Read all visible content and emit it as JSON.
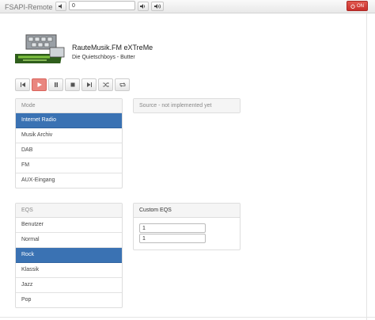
{
  "navbar": {
    "brand": "FSAPI-Remote",
    "volume_down_icon": "volume-down-icon",
    "volume_value": "0",
    "volume_up_icon": "volume-up-icon",
    "mute_icon": "mute-icon",
    "power_label": "ON",
    "power_icon": "power-icon",
    "power_color": "#d9534f"
  },
  "nowplaying": {
    "station": "RauteMusik.FM eXTreMe",
    "track": "Die Quietschboys - Butter"
  },
  "controls": {
    "icons": [
      "skip-back-icon",
      "play-icon",
      "pause-icon",
      "stop-icon",
      "skip-forward-icon",
      "shuffle-icon",
      "repeat-icon"
    ],
    "active_color": "#e9867f"
  },
  "modes": {
    "header": "Mode",
    "items": [
      "Internet Radio",
      "Musik Archiv",
      "DAB",
      "FM",
      "AUX-Eingang"
    ],
    "active": "Internet Radio"
  },
  "source": {
    "header": "Source - not implemented yet"
  },
  "eqs": {
    "header": "EQS",
    "items": [
      "Benutzer",
      "Normal",
      "Rock",
      "Klassik",
      "Jazz",
      "Pop"
    ],
    "active": "Rock"
  },
  "custom_eq": {
    "header": "Custom EQS",
    "value1": "1",
    "value2": "1"
  },
  "colors": {
    "accent": "#3a72b3"
  }
}
